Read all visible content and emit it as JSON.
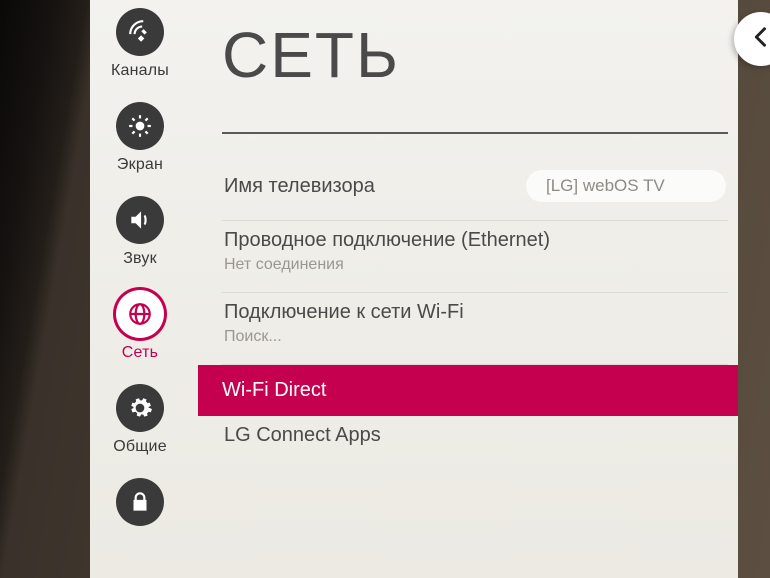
{
  "colors": {
    "accent": "#c4004f",
    "iconBg": "#3a3a3a",
    "panel": "#f0efeb"
  },
  "sidebar": {
    "items": [
      {
        "id": "channels",
        "label": "Каналы",
        "selected": false,
        "icon": "satellite"
      },
      {
        "id": "screen",
        "label": "Экран",
        "selected": false,
        "icon": "brightness"
      },
      {
        "id": "sound",
        "label": "Звук",
        "selected": false,
        "icon": "sound"
      },
      {
        "id": "network",
        "label": "Сеть",
        "selected": true,
        "icon": "globe"
      },
      {
        "id": "general",
        "label": "Общие",
        "selected": false,
        "icon": "gear"
      },
      {
        "id": "lock",
        "label": "",
        "selected": false,
        "icon": "lock"
      }
    ]
  },
  "page": {
    "title": "СЕТЬ"
  },
  "rows": {
    "tvname": {
      "label": "Имя телевизора",
      "value": "[LG] webOS TV"
    },
    "ethernet": {
      "label": "Проводное подключение (Ethernet)",
      "sub": "Нет соединения"
    },
    "wifi": {
      "label": "Подключение к сети Wi-Fi",
      "sub": "Поиск..."
    },
    "wifidirect": {
      "label": "Wi-Fi Direct"
    },
    "lgconnect": {
      "label": "LG Connect Apps"
    }
  },
  "fab": {
    "name": "back"
  }
}
